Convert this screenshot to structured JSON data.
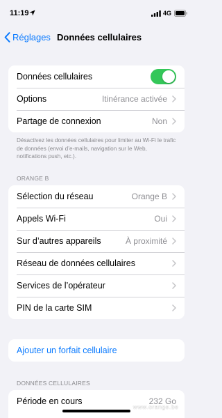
{
  "status_bar": {
    "time": "11:19",
    "network_type": "4G"
  },
  "nav": {
    "back_label": "Réglages",
    "title": "Données cellulaires"
  },
  "group1": {
    "cellular_data_label": "Données cellulaires",
    "cellular_data_enabled": true,
    "options_label": "Options",
    "options_value": "Itinérance activée",
    "hotspot_label": "Partage de connexion",
    "hotspot_value": "Non"
  },
  "group1_footer": "Désactivez les données cellulaires pour limiter au Wi-Fi le trafic de données (envoi d’e-mails, navigation sur le Web, notifications push, etc.).",
  "section_orange": {
    "header": "ORANGE B",
    "network_selection_label": "Sélection du réseau",
    "network_selection_value": "Orange B",
    "wifi_calls_label": "Appels Wi-Fi",
    "wifi_calls_value": "Oui",
    "other_devices_label": "Sur d’autres appareils",
    "other_devices_value": "À proximité",
    "cellular_network_label": "Réseau de données cellulaires",
    "carrier_services_label": "Services de l’opérateur",
    "sim_pin_label": "PIN de la carte SIM"
  },
  "add_plan_label": "Ajouter un forfait cellulaire",
  "section_cellular": {
    "header": "DONNÉES CELLULAIRES",
    "current_period_label": "Période en cours",
    "current_period_value": "232 Go"
  },
  "watermark": "www.orange.be",
  "colors": {
    "accent": "#0a7aff",
    "toggle_on": "#34c759",
    "background": "#f2f2f7"
  }
}
